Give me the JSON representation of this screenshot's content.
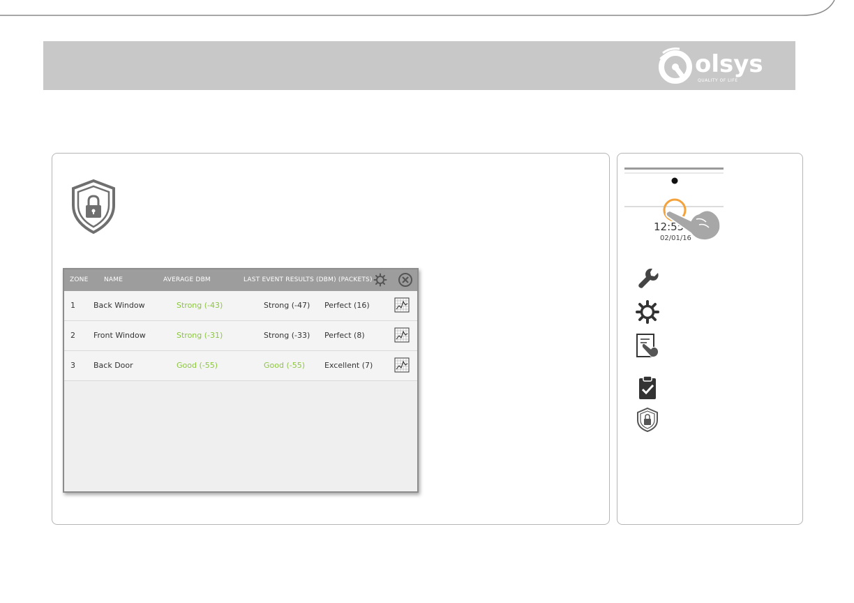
{
  "brand": {
    "name": "olsys",
    "tagline": "QUALITY OF LIFE",
    "color": "#ffffff"
  },
  "colors": {
    "header_band": "#c8c8c8",
    "strength_good": "#8cc63f",
    "highlight_ring": "#f4a23c"
  },
  "screen": {
    "columns": {
      "zone": "ZONE",
      "name": "NAME",
      "average_dbm": "AVERAGE DBM",
      "last_event": "LAST EVENT RESULTS (DBM) (PACKETS)"
    },
    "header_icons": [
      "gear-icon",
      "close-circle-icon"
    ],
    "rows": [
      {
        "zone": "1",
        "name": "Back Window",
        "average": "Strong (-43)",
        "average_green": true,
        "last_dbm": "Strong (-47)",
        "last_dbm_green": false,
        "packets": "Perfect (16)"
      },
      {
        "zone": "2",
        "name": "Front Window",
        "average": "Strong (-31)",
        "average_green": true,
        "last_dbm": "Strong (-33)",
        "last_dbm_green": false,
        "packets": "Perfect (8)"
      },
      {
        "zone": "3",
        "name": "Back Door",
        "average": "Good (-55)",
        "average_green": true,
        "last_dbm": "Good (-55)",
        "last_dbm_green": true,
        "packets": "Excellent (7)"
      }
    ]
  },
  "side": {
    "time": "12:55 P",
    "date": "02/01/16",
    "legend_icons": [
      "wrench-icon",
      "gear-icon",
      "touch-test-icon",
      "clipboard-check-icon",
      "shield-lock-icon"
    ]
  }
}
